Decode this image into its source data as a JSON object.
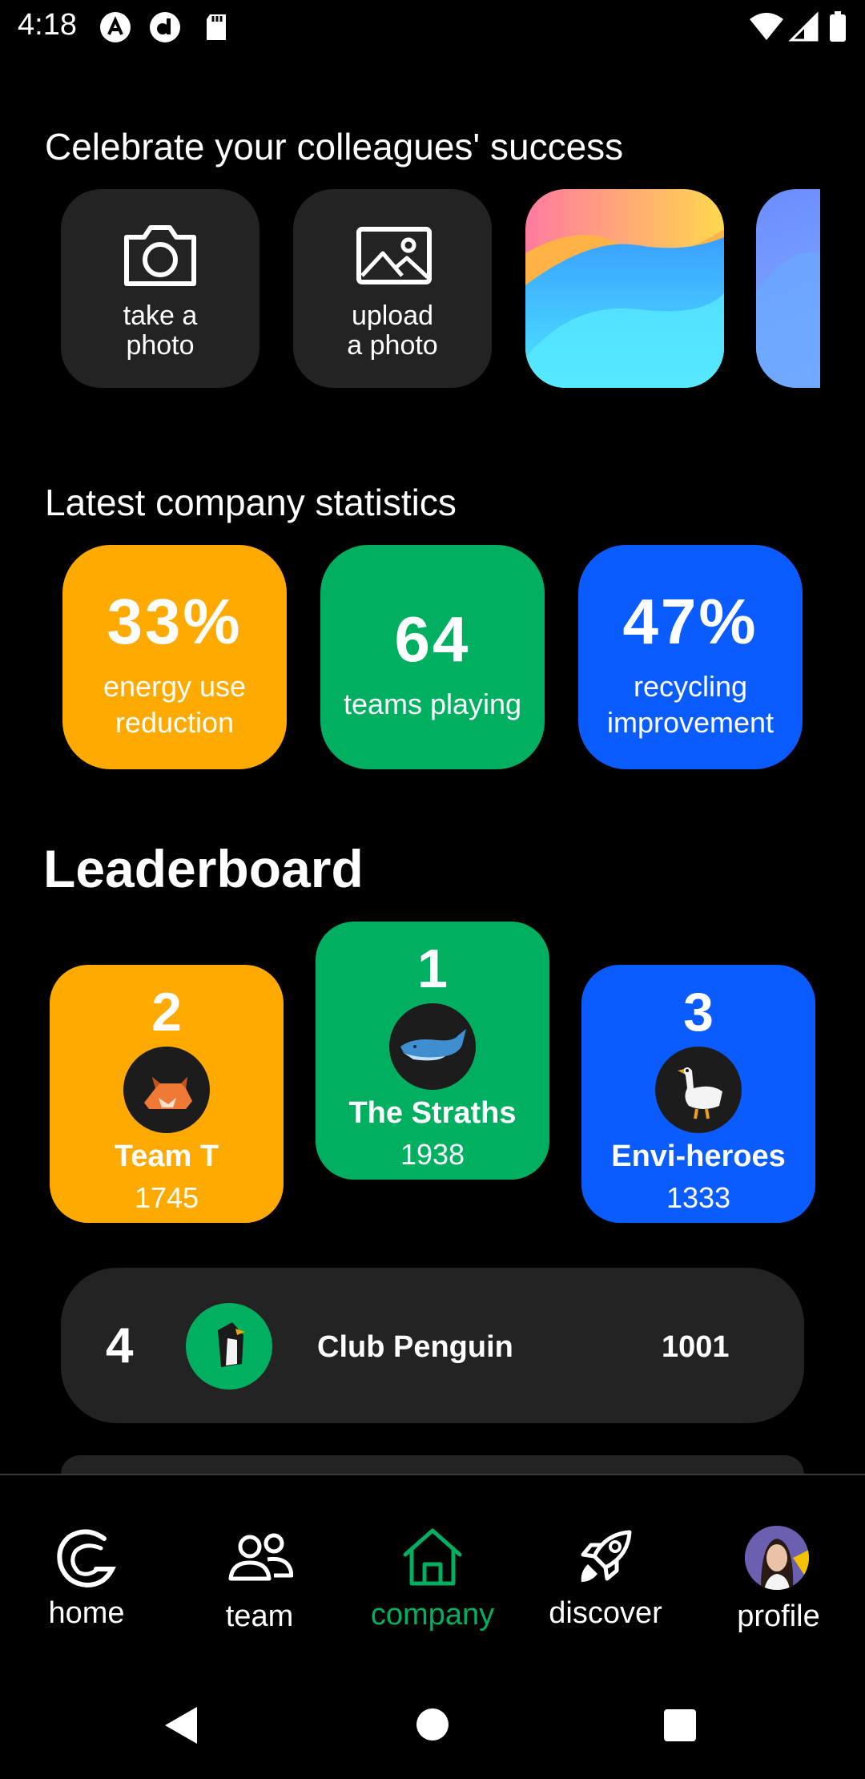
{
  "status_bar": {
    "time": "4:18"
  },
  "celebrate": {
    "title": "Celebrate your colleagues' success",
    "take_photo": "take a\nphoto",
    "upload_photo": "upload\na photo"
  },
  "stats": {
    "title": "Latest company statistics",
    "cards": [
      {
        "value": "33%",
        "label": "energy use reduction",
        "color": "#FFAA00"
      },
      {
        "value": "64",
        "label": "teams playing",
        "color": "#00B060"
      },
      {
        "value": "47%",
        "label": "recycling improvement",
        "color": "#0A5CFF"
      }
    ]
  },
  "leaderboard": {
    "title": "Leaderboard",
    "podium": [
      {
        "rank": "2",
        "name": "Team T",
        "score": "1745",
        "color": "#FFAA00",
        "avatar": "fox-icon"
      },
      {
        "rank": "1",
        "name": "The Straths",
        "score": "1938",
        "color": "#00B060",
        "avatar": "whale-icon"
      },
      {
        "rank": "3",
        "name": "Envi-heroes",
        "score": "1333",
        "color": "#0A5CFF",
        "avatar": "goose-icon"
      }
    ],
    "list": [
      {
        "rank": "4",
        "name": "Club Penguin",
        "score": "1001",
        "avatar": "penguin-icon"
      }
    ]
  },
  "nav": {
    "items": [
      {
        "label": "home",
        "icon": "home-logo-icon"
      },
      {
        "label": "team",
        "icon": "team-icon"
      },
      {
        "label": "company",
        "icon": "house-icon",
        "active": true
      },
      {
        "label": "discover",
        "icon": "rocket-icon"
      },
      {
        "label": "profile",
        "icon": "profile-avatar"
      }
    ],
    "active_color": "#00B060"
  }
}
